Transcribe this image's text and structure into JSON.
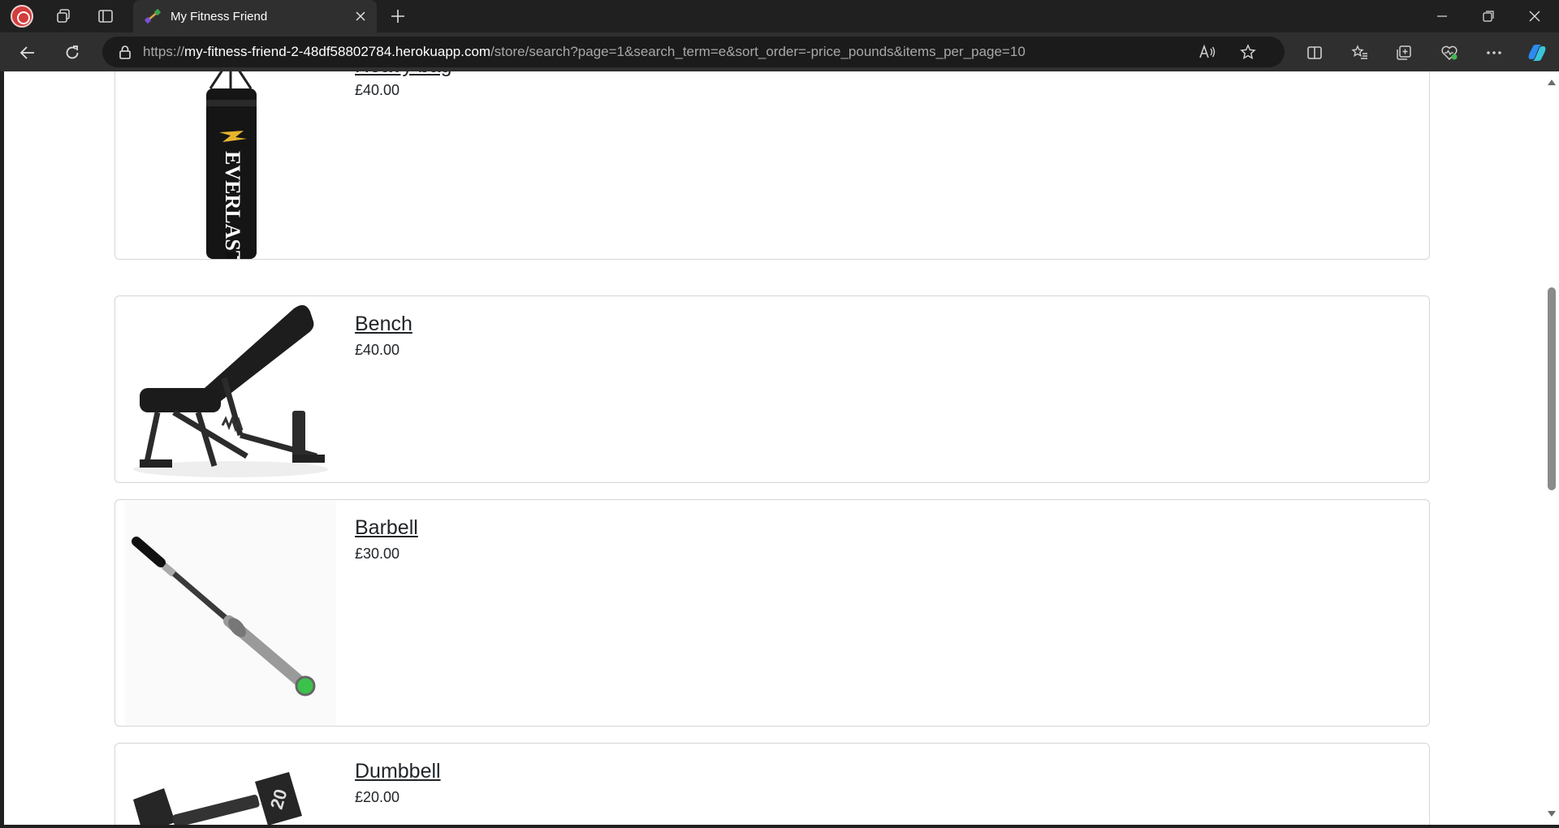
{
  "browser": {
    "tab_title": "My Fitness Friend",
    "url_prefix": "https://",
    "url_host": "my-fitness-friend-2-48df58802784.herokuapp.com",
    "url_path": "/store/search?page=1&search_term=e&sort_order=-price_pounds&items_per_page=10"
  },
  "products": [
    {
      "name": "Heavy bag",
      "price": "£40.00",
      "image_icon": "punching-bag-image"
    },
    {
      "name": "Bench",
      "price": "£40.00",
      "image_icon": "weight-bench-image"
    },
    {
      "name": "Barbell",
      "price": "£30.00",
      "image_icon": "barbell-image"
    },
    {
      "name": "Dumbbell",
      "price": "£20.00",
      "image_icon": "dumbbell-image"
    }
  ],
  "image_text": {
    "bag_brand": "EVERLAST",
    "dumbbell_weight": "20"
  },
  "colors": {
    "chrome_dark": "#202020",
    "toolbar": "#2f2f2f",
    "text": "#212529",
    "card_border": "#d6d6d6"
  }
}
